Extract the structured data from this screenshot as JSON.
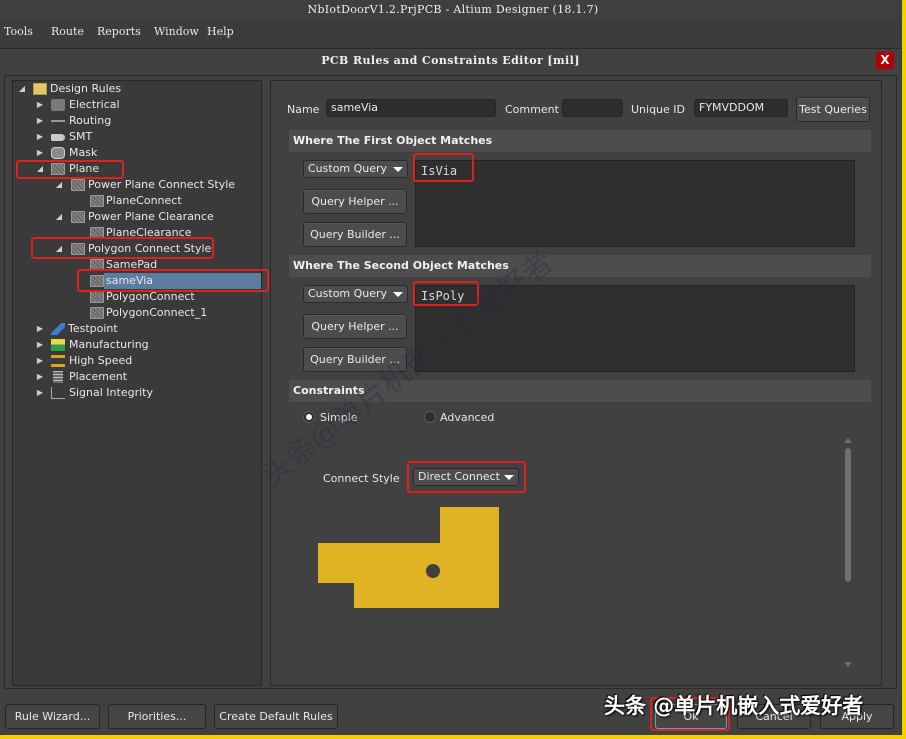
{
  "app": {
    "title": "NbIotDoorV1.2.PrjPCB - Altium Designer (18.1.7)",
    "menu": [
      {
        "label": "Tools",
        "accel": "T"
      },
      {
        "label": "Route",
        "accel": "u"
      },
      {
        "label": "Reports",
        "accel": "R"
      },
      {
        "label": "Window",
        "accel": "W"
      },
      {
        "label": "Help",
        "accel": "H"
      }
    ]
  },
  "dialog": {
    "title": "PCB Rules and Constraints Editor [mil]",
    "close_label": "X"
  },
  "tree": {
    "items": [
      {
        "label": "Design Rules",
        "level": 0,
        "expanded": true,
        "icon": "design-rules-folder-icon"
      },
      {
        "label": "Electrical",
        "level": 1,
        "expanded": false,
        "icon": "electrical-icon"
      },
      {
        "label": "Routing",
        "level": 1,
        "expanded": false,
        "icon": "routing-icon"
      },
      {
        "label": "SMT",
        "level": 1,
        "expanded": false,
        "icon": "smt-icon"
      },
      {
        "label": "Mask",
        "level": 1,
        "expanded": false,
        "icon": "mask-icon"
      },
      {
        "label": "Plane",
        "level": 1,
        "expanded": true,
        "icon": "plane-icon"
      },
      {
        "label": "Power Plane Connect Style",
        "level": 2,
        "expanded": true,
        "icon": "rule-category-icon"
      },
      {
        "label": "PlaneConnect",
        "level": 3,
        "icon": "rule-icon"
      },
      {
        "label": "Power Plane Clearance",
        "level": 2,
        "expanded": true,
        "icon": "rule-category-icon"
      },
      {
        "label": "PlaneClearance",
        "level": 3,
        "icon": "rule-icon"
      },
      {
        "label": "Polygon Connect Style",
        "level": 2,
        "expanded": true,
        "icon": "rule-category-icon"
      },
      {
        "label": "SamePad",
        "level": 3,
        "icon": "rule-icon"
      },
      {
        "label": "sameVia",
        "level": 3,
        "icon": "rule-icon",
        "selected": true
      },
      {
        "label": "PolygonConnect",
        "level": 3,
        "icon": "rule-icon"
      },
      {
        "label": "PolygonConnect_1",
        "level": 3,
        "icon": "rule-icon"
      },
      {
        "label": "Testpoint",
        "level": 1,
        "expanded": false,
        "icon": "testpoint-icon"
      },
      {
        "label": "Manufacturing",
        "level": 1,
        "expanded": false,
        "icon": "manufacturing-icon"
      },
      {
        "label": "High Speed",
        "level": 1,
        "expanded": false,
        "icon": "high-speed-icon"
      },
      {
        "label": "Placement",
        "level": 1,
        "expanded": false,
        "icon": "placement-icon"
      },
      {
        "label": "Signal Integrity",
        "level": 1,
        "expanded": false,
        "icon": "signal-integrity-icon"
      }
    ]
  },
  "rule": {
    "name_label": "Name",
    "name_value": "sameVia",
    "comment_label": "Comment",
    "comment_value": "",
    "uid_label": "Unique ID",
    "uid_value": "FYMVDDOM",
    "test_queries_label": "Test Queries",
    "first": {
      "header": "Where The First Object Matches",
      "query_type": "Custom Query",
      "query_helper_label": "Query Helper ...",
      "query_builder_label": "Query Builder ...",
      "query_text": "IsVia"
    },
    "second": {
      "header": "Where The Second Object Matches",
      "query_type": "Custom Query",
      "query_helper_label": "Query Helper ...",
      "query_builder_label": "Query Builder ...",
      "query_text": "IsPoly"
    },
    "constraints": {
      "header": "Constraints",
      "mode_simple": "Simple",
      "mode_advanced": "Advanced",
      "selected_mode": "Simple",
      "connect_style_label": "Connect Style",
      "connect_style_value": "Direct Connect",
      "preview_color": "#e0b325"
    }
  },
  "footer": {
    "rule_wizard": "Rule Wizard...",
    "priorities": "Priorities...",
    "create_default_rules": "Create Default Rules",
    "ok": "Ok",
    "cancel": "Cancel",
    "apply": "Apply"
  },
  "watermark": {
    "diagonal": "头条@单片机嵌入式爱好者",
    "corner": "头条 @单片机嵌入式爱好者"
  },
  "colors": {
    "highlight_box": "#e02020",
    "selection": "#5b7ba0",
    "close_button": "#b30000",
    "window_frame_accent": "#f5d000"
  }
}
